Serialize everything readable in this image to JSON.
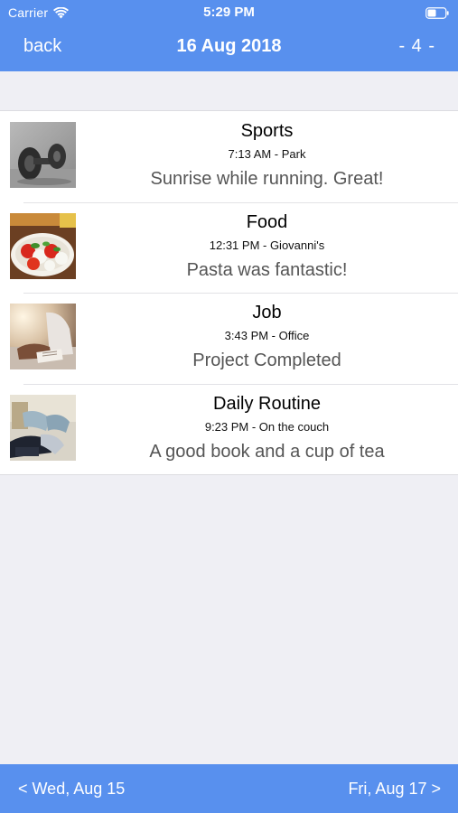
{
  "status_bar": {
    "carrier": "Carrier",
    "time": "5:29 PM",
    "icons": [
      "wifi-icon",
      "battery-icon"
    ]
  },
  "nav": {
    "back_label": "back",
    "title": "16 Aug 2018",
    "count_label": "- 4 -"
  },
  "entries": [
    {
      "thumb_icon": "dumbbell-photo",
      "title": "Sports",
      "subtitle": "7:13 AM - Park",
      "note": "Sunrise while running. Great!"
    },
    {
      "thumb_icon": "caprese-food-photo",
      "title": "Food",
      "subtitle": "12:31 PM - Giovanni's",
      "note": "Pasta was fantastic!"
    },
    {
      "thumb_icon": "office-desk-photo",
      "title": "Job",
      "subtitle": "3:43 PM - Office",
      "note": "Project Completed"
    },
    {
      "thumb_icon": "reading-couch-photo",
      "title": "Daily Routine",
      "subtitle": "9:23 PM - On the couch",
      "note": "A good book and a cup of tea"
    }
  ],
  "footer": {
    "prev_label": "< Wed, Aug 15",
    "next_label": "Fri, Aug 17 >"
  },
  "colors": {
    "bar": "#5890ee",
    "background": "#efeff4",
    "list_bg": "#ffffff",
    "note_text": "#555555"
  }
}
